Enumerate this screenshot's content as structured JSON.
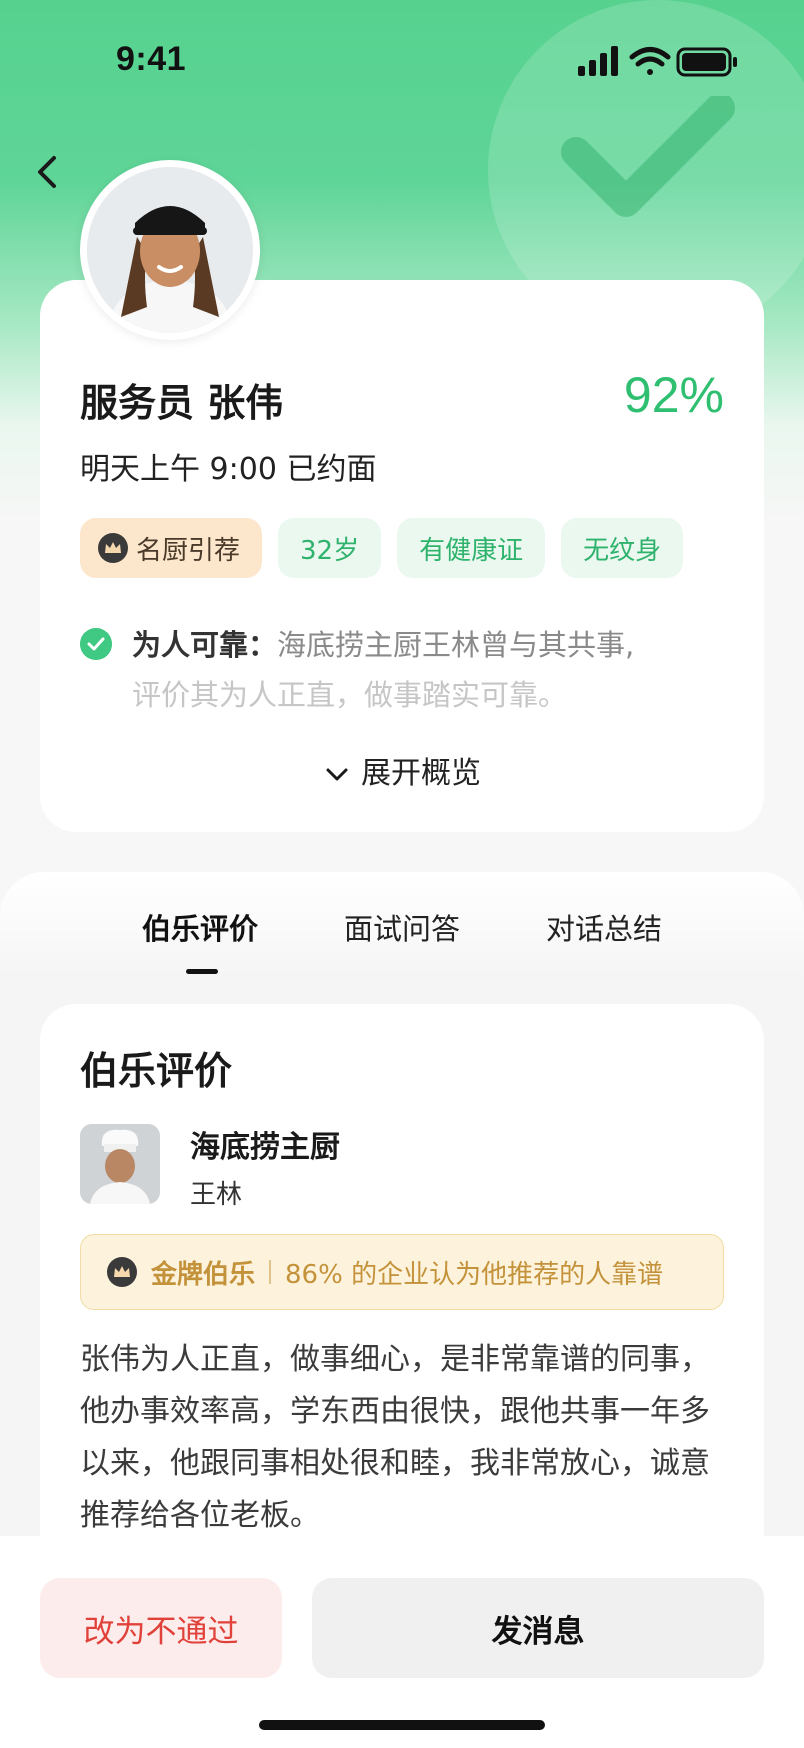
{
  "status_bar": {
    "time": "9:41"
  },
  "candidate": {
    "name": "服务员 张伟",
    "match_percent": "92%",
    "interview": "明天上午 9:00 已约面",
    "tags": [
      {
        "label": "名厨引荐",
        "kind": "chef",
        "icon": "crown-icon"
      },
      {
        "label": "32岁",
        "kind": "green"
      },
      {
        "label": "有健康证",
        "kind": "green"
      },
      {
        "label": "无纹身",
        "kind": "green"
      }
    ],
    "highlight_title": "为人可靠：",
    "highlight_text_line1": "海底捞主厨王林曾与其共事,",
    "highlight_text_line2": "评价其为人正直，做事踏实可靠。",
    "expand_label": "展开概览"
  },
  "tabs": [
    {
      "label": "伯乐评价",
      "active": true
    },
    {
      "label": "面试问答",
      "active": false
    },
    {
      "label": "对话总结",
      "active": false
    }
  ],
  "review": {
    "title": "伯乐评价",
    "reviewer_org": "海底捞主厨",
    "reviewer_name": "王林",
    "badge_label": "金牌伯乐",
    "badge_desc": "86% 的企业认为他推荐的人靠谱",
    "body": "张伟为人正直，做事细心，是非常靠谱的同事，他办事效率高，学东西由很快，跟他共事一年多以来，他跟同事相处很和睦，我非常放心，诚意推荐给各位老板。"
  },
  "actions": {
    "reject_label": "改为不通过",
    "message_label": "发消息"
  },
  "colors": {
    "accent_green": "#2fbf71",
    "header_green": "#56d28e",
    "reject_red": "#e0423a",
    "gold": "#c4923a"
  }
}
